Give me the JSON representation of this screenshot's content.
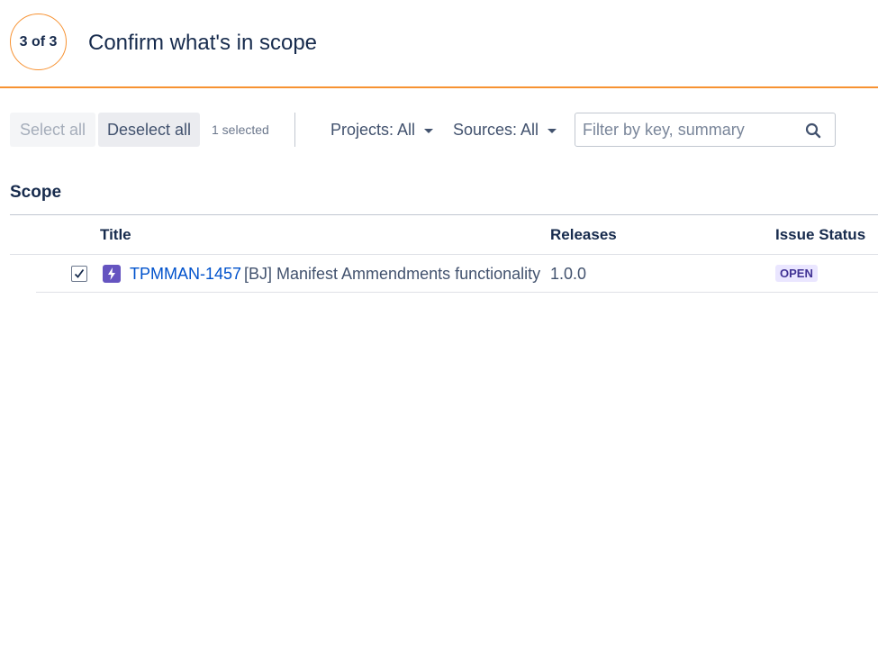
{
  "header": {
    "step_label": "3 of 3",
    "title": "Confirm what's in scope",
    "accent_color": "#f79232"
  },
  "toolbar": {
    "select_all_label": "Select all",
    "deselect_all_label": "Deselect all",
    "selected_count": "1 selected",
    "projects_filter": "Projects: All",
    "sources_filter": "Sources: All",
    "search": {
      "placeholder": "Filter by key, summary",
      "value": "",
      "icon": "search-icon"
    }
  },
  "scope": {
    "section_title": "Scope",
    "columns": {
      "title": "Title",
      "releases": "Releases",
      "status": "Issue Status"
    },
    "rows": [
      {
        "checked": true,
        "issue_type_icon": "epic-lightning-icon",
        "issue_type_color": "#6554c0",
        "key": "TPMMAN-1457",
        "summary": "[BJ] Manifest Ammendments functionality",
        "release": "1.0.0",
        "status": "OPEN",
        "status_color": "#403294",
        "status_bg": "#eae6ff"
      }
    ]
  }
}
